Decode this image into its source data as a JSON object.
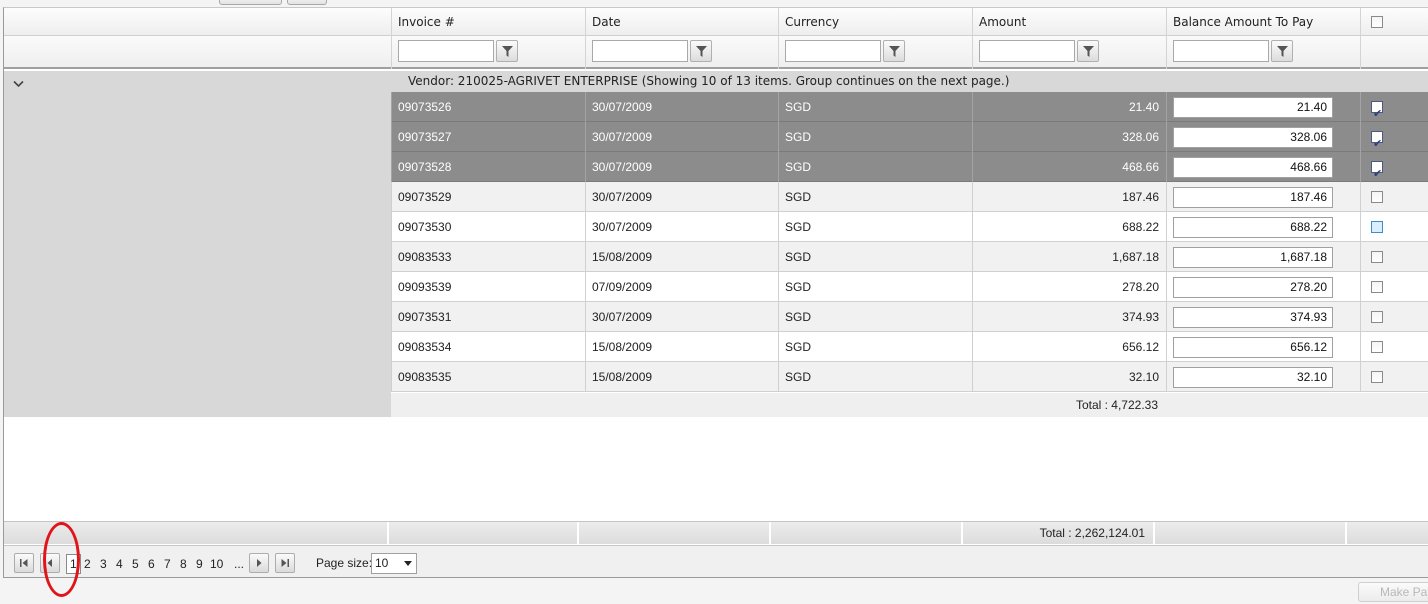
{
  "columns": {
    "invoice": "Invoice #",
    "date": "Date",
    "currency": "Currency",
    "amount": "Amount",
    "balance": "Balance Amount To Pay"
  },
  "group": {
    "header": "Vendor: 210025-AGRIVET ENTERPRISE (Showing 10 of 13 items. Group continues on the next page.)",
    "total": "Total : 4,722.33"
  },
  "rows": [
    {
      "invoice": "09073526",
      "date": "30/07/2009",
      "currency": "SGD",
      "amount": "21.40",
      "balance": "21.40",
      "checked": true,
      "selected": true
    },
    {
      "invoice": "09073527",
      "date": "30/07/2009",
      "currency": "SGD",
      "amount": "328.06",
      "balance": "328.06",
      "checked": true,
      "selected": true
    },
    {
      "invoice": "09073528",
      "date": "30/07/2009",
      "currency": "SGD",
      "amount": "468.66",
      "balance": "468.66",
      "checked": true,
      "selected": true
    },
    {
      "invoice": "09073529",
      "date": "30/07/2009",
      "currency": "SGD",
      "amount": "187.46",
      "balance": "187.46",
      "checked": false,
      "selected": false
    },
    {
      "invoice": "09073530",
      "date": "30/07/2009",
      "currency": "SGD",
      "amount": "688.22",
      "balance": "688.22",
      "checked": false,
      "selected": false
    },
    {
      "invoice": "09083533",
      "date": "15/08/2009",
      "currency": "SGD",
      "amount": "1,687.18",
      "balance": "1,687.18",
      "checked": false,
      "selected": false
    },
    {
      "invoice": "09093539",
      "date": "07/09/2009",
      "currency": "SGD",
      "amount": "278.20",
      "balance": "278.20",
      "checked": false,
      "selected": false
    },
    {
      "invoice": "09073531",
      "date": "30/07/2009",
      "currency": "SGD",
      "amount": "374.93",
      "balance": "374.93",
      "checked": false,
      "selected": false
    },
    {
      "invoice": "09083534",
      "date": "15/08/2009",
      "currency": "SGD",
      "amount": "656.12",
      "balance": "656.12",
      "checked": false,
      "selected": false
    },
    {
      "invoice": "09083535",
      "date": "15/08/2009",
      "currency": "SGD",
      "amount": "32.10",
      "balance": "32.10",
      "checked": false,
      "selected": false
    }
  ],
  "grand_total": "Total : 2,262,124.01",
  "pager": {
    "pages": [
      "1",
      "2",
      "3",
      "4",
      "5",
      "6",
      "7",
      "8",
      "9",
      "10",
      "..."
    ],
    "current": "1",
    "page_size_label": "Page size:",
    "page_size": "10"
  },
  "make_payment": "Make Pay",
  "colors": {
    "selected_row": "#8c8c8c",
    "alt_row": "#f1f1f1",
    "annotation": "#e0151b"
  }
}
